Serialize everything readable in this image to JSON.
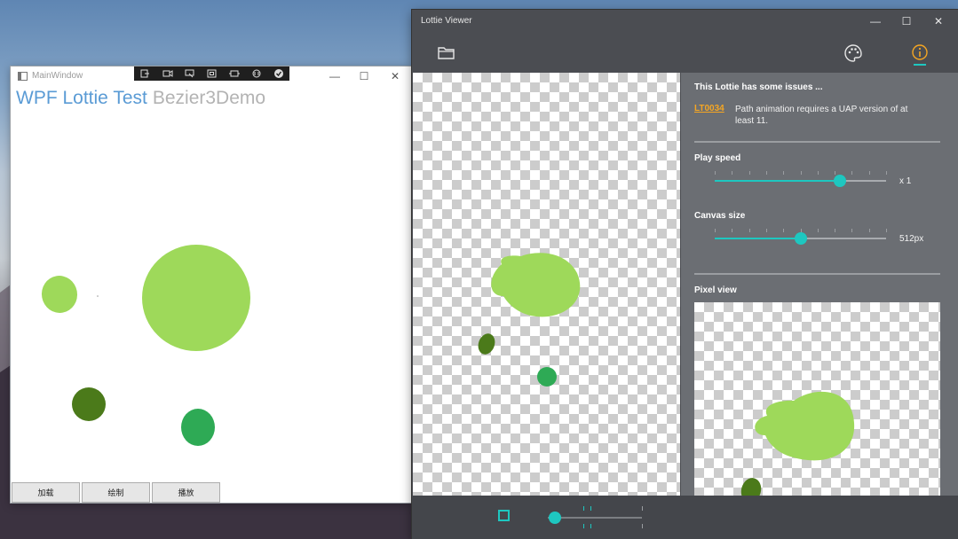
{
  "wpf_window": {
    "title": "MainWindow",
    "controls": {
      "minimize": "—",
      "maximize": "☐",
      "close": "✕"
    },
    "heading_primary": "WPF Lottie Test",
    "heading_secondary": "Bezier3Demo",
    "buttons": [
      "加载",
      "绘制",
      "播放"
    ],
    "shapes_colors": {
      "light_green": "#9ed95a",
      "dark_green": "#4b7a1a",
      "mid_green": "#2eaa55"
    }
  },
  "lottie_viewer": {
    "title": "Lottie Viewer",
    "controls": {
      "minimize": "—",
      "maximize": "☐",
      "close": "✕"
    },
    "issues": {
      "title": "This Lottie has some issues ...",
      "code": "LT0034",
      "message": "Path animation requires a UAP version of at least 11."
    },
    "play_speed": {
      "label": "Play speed",
      "value_label": "x 1",
      "position": 0.73
    },
    "canvas_size": {
      "label": "Canvas size",
      "value_label": "512px",
      "position": 0.5
    },
    "pixel_view": {
      "label": "Pixel view"
    },
    "playback": {
      "progress": 0.08
    },
    "accent_color": "#1ec7c0",
    "warning_color": "#f5a623"
  }
}
